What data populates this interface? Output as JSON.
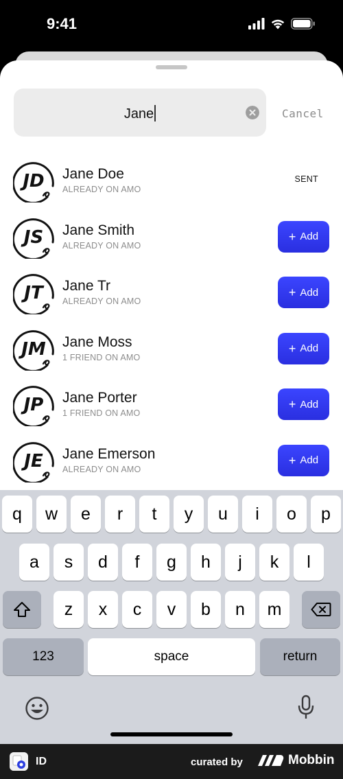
{
  "status_bar": {
    "time": "9:41"
  },
  "search": {
    "query": "Jane",
    "cancel_label": "Cancel"
  },
  "contacts": [
    {
      "initials": "JD",
      "name": "Jane Doe",
      "subtitle": "ALREADY ON AMO",
      "action": "sent",
      "action_label": "SENT"
    },
    {
      "initials": "JS",
      "name": "Jane Smith",
      "subtitle": "ALREADY ON AMO",
      "action": "add",
      "action_label": "Add"
    },
    {
      "initials": "JT",
      "name": "Jane Tr",
      "subtitle": "ALREADY ON AMO",
      "action": "add",
      "action_label": "Add"
    },
    {
      "initials": "JM",
      "name": "Jane Moss",
      "subtitle": "1 FRIEND ON AMO",
      "action": "add",
      "action_label": "Add"
    },
    {
      "initials": "JP",
      "name": "Jane Porter",
      "subtitle": "1 FRIEND ON AMO",
      "action": "add",
      "action_label": "Add"
    },
    {
      "initials": "JE",
      "name": "Jane Emerson",
      "subtitle": "ALREADY ON AMO",
      "action": "add",
      "action_label": "Add"
    }
  ],
  "keyboard": {
    "row1": [
      "q",
      "w",
      "e",
      "r",
      "t",
      "y",
      "u",
      "i",
      "o",
      "p"
    ],
    "row2": [
      "a",
      "s",
      "d",
      "f",
      "g",
      "h",
      "j",
      "k",
      "l"
    ],
    "row3": [
      "z",
      "x",
      "c",
      "v",
      "b",
      "n",
      "m"
    ],
    "numbers_label": "123",
    "space_label": "space",
    "return_label": "return"
  },
  "footer": {
    "app_label": "ID",
    "curated_label": "curated by",
    "brand_label": "Mobbin"
  },
  "colors": {
    "accent": "#3b45ff",
    "sheet": "#ffffff",
    "keyboard": "#d1d4db",
    "footer": "#1b1b1b"
  }
}
